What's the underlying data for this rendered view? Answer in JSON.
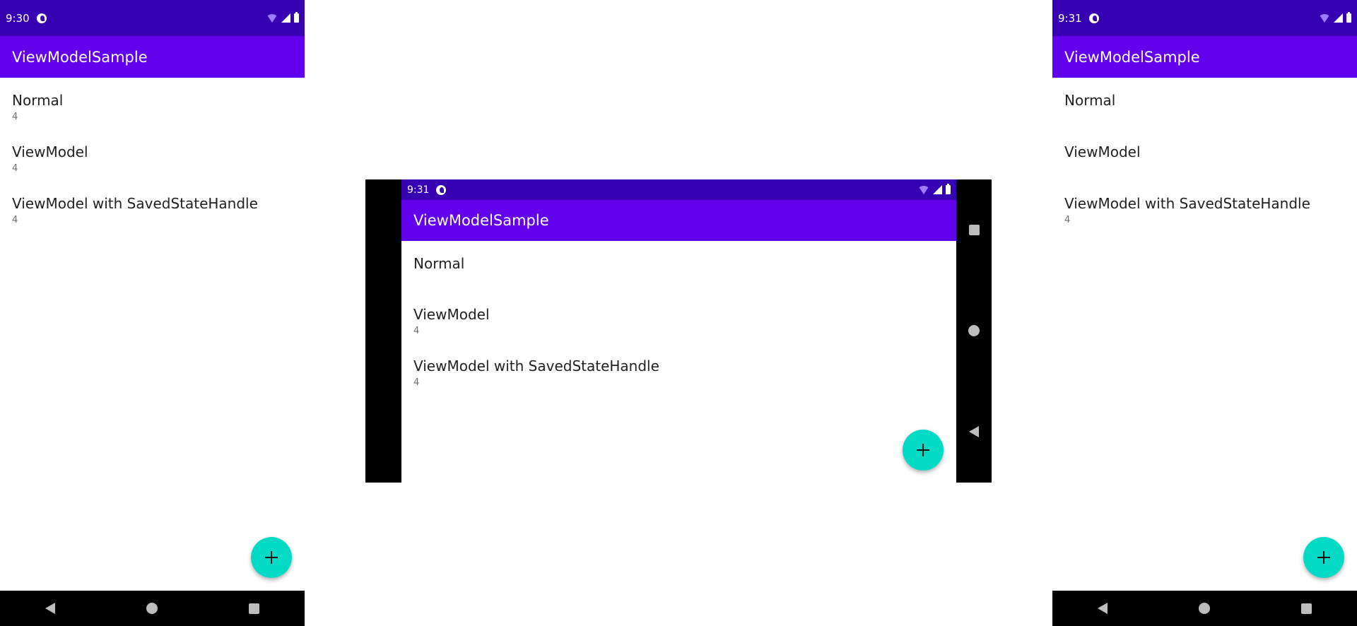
{
  "colors": {
    "status_bar": "#3700b3",
    "app_bar": "#6200ee",
    "fab": "#03dac5",
    "nav_bar": "#000000"
  },
  "screens": {
    "left": {
      "time": "9:30",
      "app_title": "ViewModelSample",
      "items": [
        {
          "title": "Normal",
          "count": "4"
        },
        {
          "title": "ViewModel",
          "count": "4"
        },
        {
          "title": "ViewModel with SavedStateHandle",
          "count": "4"
        }
      ],
      "fab_icon": "plus-icon"
    },
    "middle": {
      "time": "9:31",
      "app_title": "ViewModelSample",
      "items": [
        {
          "title": "Normal",
          "count": ""
        },
        {
          "title": "ViewModel",
          "count": "4"
        },
        {
          "title": "ViewModel with SavedStateHandle",
          "count": "4"
        }
      ],
      "fab_icon": "plus-icon"
    },
    "right": {
      "time": "9:31",
      "app_title": "ViewModelSample",
      "items": [
        {
          "title": "Normal",
          "count": ""
        },
        {
          "title": "ViewModel",
          "count": ""
        },
        {
          "title": "ViewModel with SavedStateHandle",
          "count": "4"
        }
      ],
      "fab_icon": "plus-icon"
    }
  }
}
